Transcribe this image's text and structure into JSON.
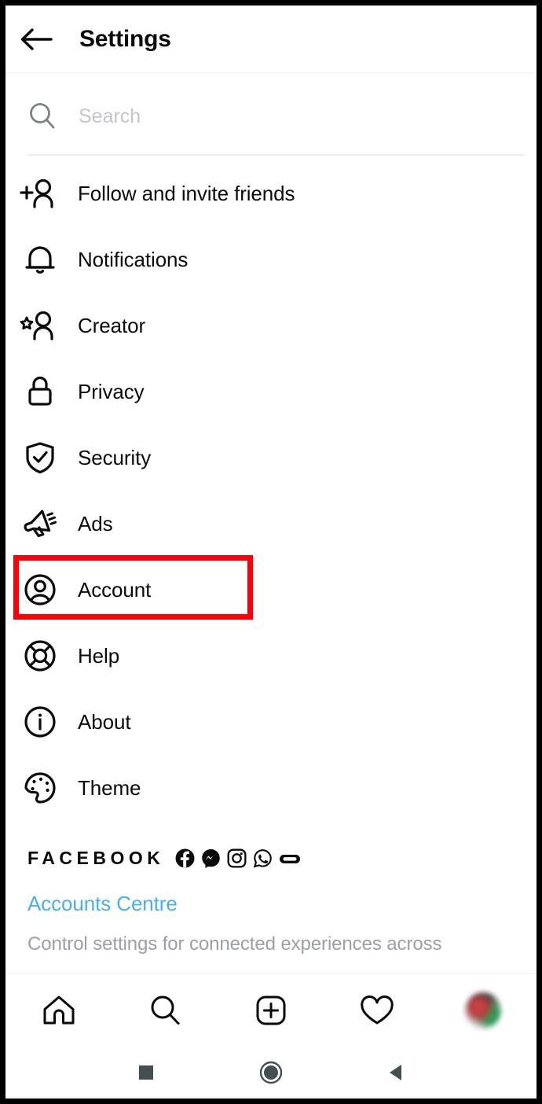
{
  "app": {
    "name": "Instagram",
    "screen": "Settings"
  },
  "header": {
    "title": "Settings",
    "back_icon": "arrow-left-icon"
  },
  "search": {
    "value": "",
    "placeholder": "Search",
    "icon": "search-icon"
  },
  "menu": {
    "items": [
      {
        "label": "Follow and invite friends",
        "icon": "person-plus-icon"
      },
      {
        "label": "Notifications",
        "icon": "bell-icon"
      },
      {
        "label": "Creator",
        "icon": "person-star-icon"
      },
      {
        "label": "Privacy",
        "icon": "lock-icon"
      },
      {
        "label": "Security",
        "icon": "shield-check-icon"
      },
      {
        "label": "Ads",
        "icon": "megaphone-icon"
      },
      {
        "label": "Account",
        "icon": "account-circle-icon"
      },
      {
        "label": "Help",
        "icon": "lifebuoy-icon"
      },
      {
        "label": "About",
        "icon": "info-circle-icon"
      },
      {
        "label": "Theme",
        "icon": "palette-icon"
      }
    ],
    "highlighted_item": "Account",
    "highlight_color": "#fb0007"
  },
  "facebook_section": {
    "wordmark": "FACEBOOK",
    "apps": [
      {
        "name": "facebook-icon"
      },
      {
        "name": "messenger-icon"
      },
      {
        "name": "instagram-icon"
      },
      {
        "name": "whatsapp-icon"
      },
      {
        "name": "oculus-icon"
      }
    ],
    "link_label": "Accounts Centre",
    "link_color": "#49afef",
    "description": "Control settings for connected experiences across"
  },
  "tabbar": {
    "items": [
      {
        "name": "home-icon"
      },
      {
        "name": "search-icon"
      },
      {
        "name": "add-post-icon"
      },
      {
        "name": "activity-heart-icon"
      },
      {
        "name": "profile-avatar"
      }
    ]
  },
  "system_nav": {
    "color": "#434f50",
    "items": [
      {
        "name": "recents-square-icon"
      },
      {
        "name": "home-circle-icon"
      },
      {
        "name": "back-triangle-icon"
      }
    ]
  }
}
